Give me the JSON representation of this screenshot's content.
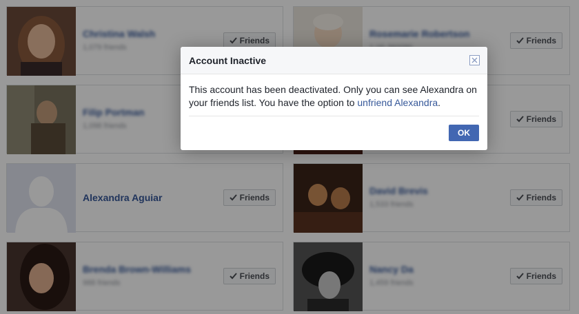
{
  "friends": [
    {
      "name": "Christina Walsh",
      "subtitle": "1,079 friends",
      "blurred": true
    },
    {
      "name": "Rosemarie Robertson",
      "subtitle": "1 (4) 360090",
      "blurred": true
    },
    {
      "name": "Filip Portman",
      "subtitle": "1,098 friends",
      "blurred": true
    },
    {
      "name": "",
      "subtitle": "",
      "blurred": true
    },
    {
      "name": "Alexandra Aguiar",
      "subtitle": "",
      "blurred": false
    },
    {
      "name": "David Brevis",
      "subtitle": "1,533 friends",
      "blurred": true
    },
    {
      "name": "Brenda Brown-Williams",
      "subtitle": "988 friends",
      "blurred": true
    },
    {
      "name": "Nancy Da",
      "subtitle": "1,459 friends",
      "blurred": true
    }
  ],
  "friends_button_label": "Friends",
  "dialog": {
    "title": "Account Inactive",
    "body_text": "This account has been deactivated. Only you can see Alexandra on your friends list. You have the option to ",
    "link_text": "unfriend Alexandra",
    "body_suffix": ".",
    "ok_label": "OK"
  },
  "colors": {
    "link": "#365899",
    "primary_button": "#4267b2",
    "overlay": "rgba(0,0,0,0.40)"
  }
}
